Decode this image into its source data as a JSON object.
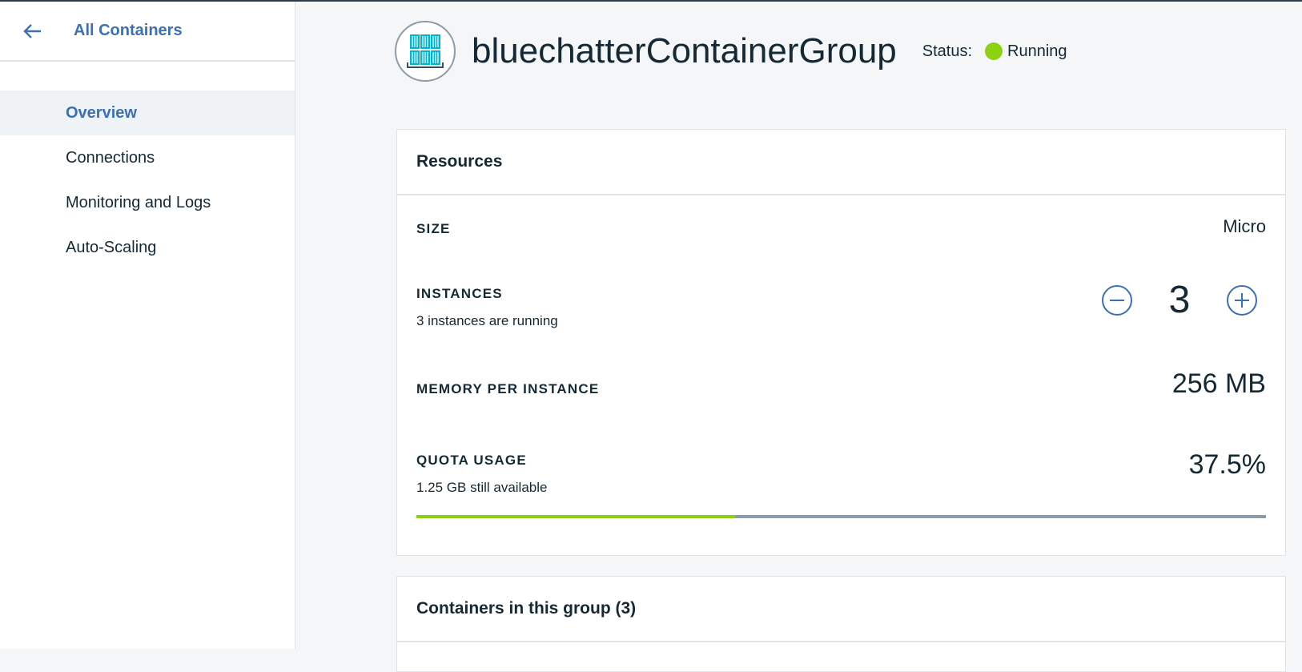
{
  "sidebar": {
    "back_label": "All Containers",
    "items": [
      {
        "label": "Overview",
        "active": true
      },
      {
        "label": "Connections"
      },
      {
        "label": "Monitoring and Logs"
      },
      {
        "label": "Auto-Scaling"
      }
    ]
  },
  "header": {
    "title": "bluechatterContainerGroup",
    "status_label": "Status:",
    "status_value": "Running",
    "status_color": "#8cd211",
    "icon": "container-group-icon"
  },
  "resources": {
    "title": "Resources",
    "size": {
      "label": "SIZE",
      "value": "Micro"
    },
    "instances": {
      "label": "INSTANCES",
      "sub": "3 instances are running",
      "count": "3"
    },
    "memory": {
      "label": "MEMORY PER INSTANCE",
      "value": "256 MB"
    },
    "quota": {
      "label": "QUOTA USAGE",
      "sub": "1.25 GB still available",
      "value": "37.5%",
      "fraction": 0.375
    }
  },
  "containers": {
    "title": "Containers in this group (3)"
  },
  "colors": {
    "accent": "#3d70b2",
    "icon_teal": "#00b4cc",
    "quota_fill": "#8cd211",
    "quota_track": "#8c9ba5"
  }
}
